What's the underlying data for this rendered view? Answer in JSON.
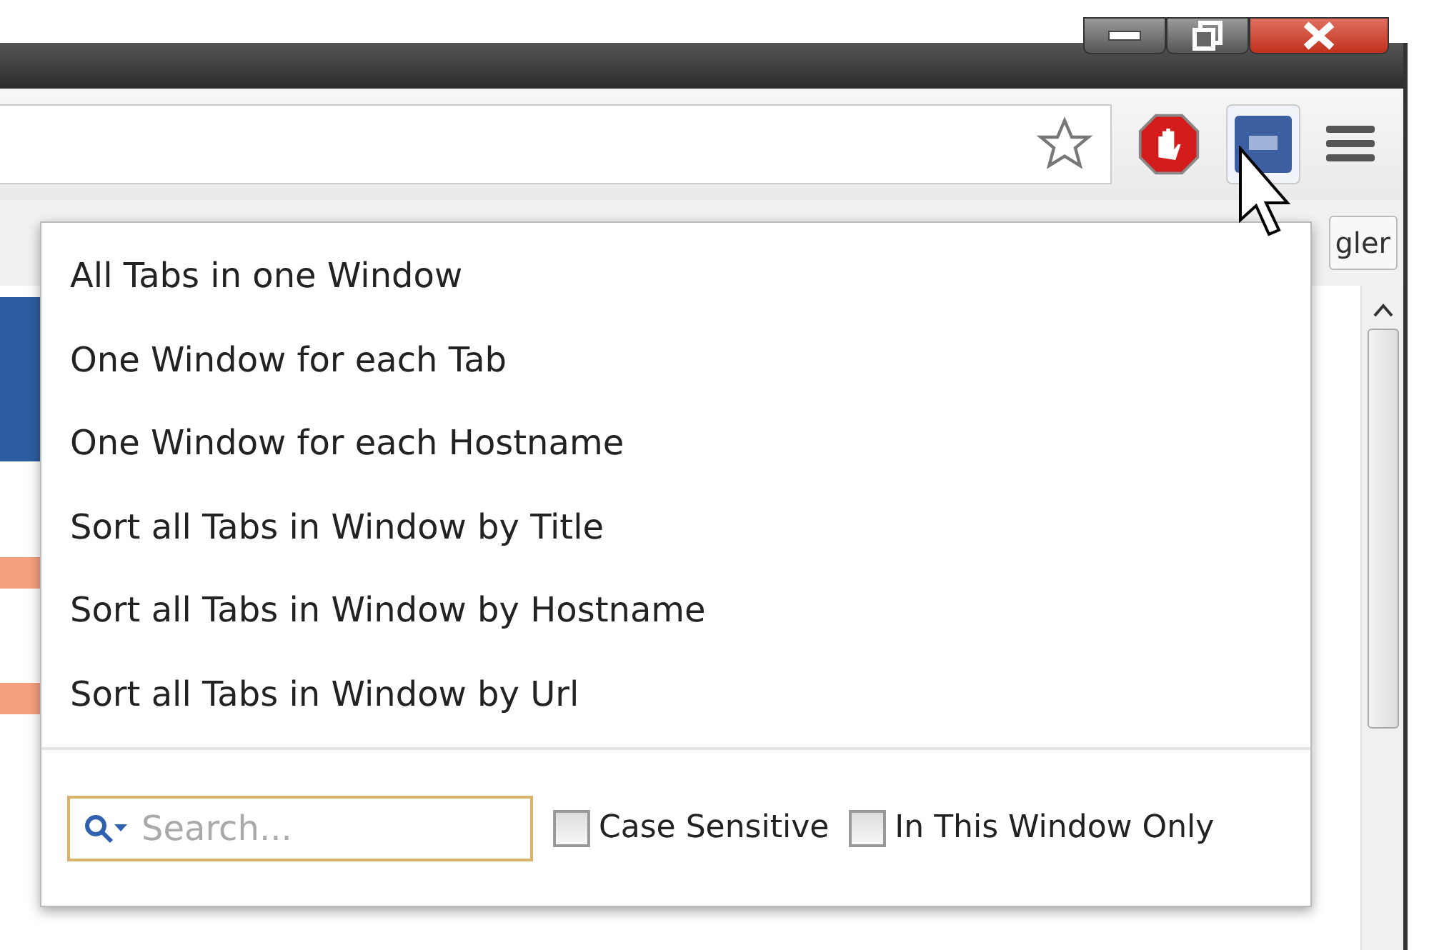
{
  "bookmark_bar": {
    "button_label": "gler"
  },
  "menu": {
    "items": [
      {
        "label": "All Tabs in one Window"
      },
      {
        "label": "One Window for each Tab"
      },
      {
        "label": "One Window for each Hostname"
      },
      {
        "label": "Sort all Tabs in Window by Title"
      },
      {
        "label": "Sort all Tabs in Window by Hostname"
      },
      {
        "label": "Sort all Tabs in Window by Url"
      }
    ]
  },
  "search": {
    "placeholder": "Search..."
  },
  "options": [
    {
      "label": "Case Sensitive",
      "checked": false
    },
    {
      "label": "In This Window Only",
      "checked": false
    }
  ]
}
